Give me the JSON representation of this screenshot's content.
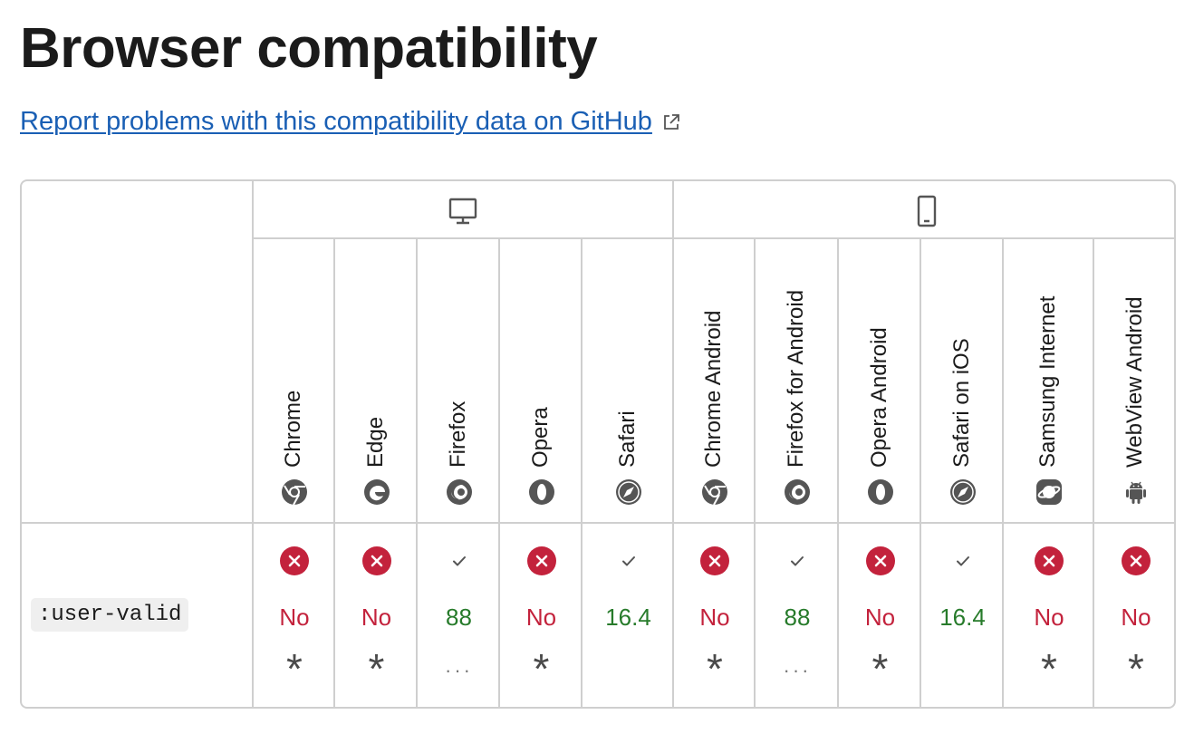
{
  "page": {
    "title": "Browser compatibility",
    "report_link": "Report problems with this compatibility data on GitHub"
  },
  "platforms": [
    {
      "name": "desktop",
      "icon": "desktop-icon"
    },
    {
      "name": "mobile",
      "icon": "mobile-icon"
    }
  ],
  "browsers": [
    {
      "name": "Chrome",
      "icon": "chrome-icon"
    },
    {
      "name": "Edge",
      "icon": "edge-icon"
    },
    {
      "name": "Firefox",
      "icon": "firefox-icon"
    },
    {
      "name": "Opera",
      "icon": "opera-icon"
    },
    {
      "name": "Safari",
      "icon": "safari-icon"
    },
    {
      "name": "Chrome Android",
      "icon": "chrome-icon"
    },
    {
      "name": "Firefox for Android",
      "icon": "firefox-icon"
    },
    {
      "name": "Opera Android",
      "icon": "opera-icon"
    },
    {
      "name": "Safari on iOS",
      "icon": "safari-icon"
    },
    {
      "name": "Samsung Internet",
      "icon": "samsung-internet-icon"
    },
    {
      "name": "WebView Android",
      "icon": "android-icon"
    }
  ],
  "feature": {
    "name": ":user-valid",
    "support": [
      {
        "status": "no",
        "version": "No",
        "note": "*"
      },
      {
        "status": "no",
        "version": "No",
        "note": "*"
      },
      {
        "status": "yes",
        "version": "88",
        "note": "···"
      },
      {
        "status": "no",
        "version": "No",
        "note": "*"
      },
      {
        "status": "yes",
        "version": "16.4",
        "note": ""
      },
      {
        "status": "no",
        "version": "No",
        "note": "*"
      },
      {
        "status": "yes",
        "version": "88",
        "note": "···"
      },
      {
        "status": "no",
        "version": "No",
        "note": "*"
      },
      {
        "status": "yes",
        "version": "16.4",
        "note": ""
      },
      {
        "status": "no",
        "version": "No",
        "note": "*"
      },
      {
        "status": "no",
        "version": "No",
        "note": "*"
      }
    ]
  },
  "colors": {
    "no": "#c3223c",
    "yes": "#277b2b",
    "link": "#1a5fb4",
    "border": "#cfcfcf",
    "icon_gray": "#555555"
  }
}
